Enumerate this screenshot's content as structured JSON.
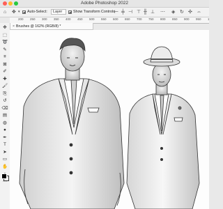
{
  "window": {
    "title": "Adobe Photoshop 2022"
  },
  "options_bar": {
    "home_icon": "home-icon",
    "move_icon": "move-tool-icon",
    "auto_select_label": "Auto-Select:",
    "auto_select_checked": true,
    "auto_select_value": "Layer",
    "show_transform_label": "Show Transform Controls",
    "show_transform_checked": true
  },
  "ruler": {
    "ticks": [
      "200",
      "250",
      "300",
      "350",
      "400",
      "450",
      "500",
      "550",
      "600",
      "650",
      "700",
      "750",
      "800",
      "850",
      "900",
      "950",
      "1000"
    ]
  },
  "document": {
    "tab_label": "Brushes @ 162% (RGB/8) *"
  },
  "tools": [
    "move-tool-icon",
    "marquee-tool-icon",
    "lasso-tool-icon",
    "quick-select-tool-icon",
    "crop-tool-icon",
    "frame-tool-icon",
    "eyedropper-tool-icon",
    "healing-brush-icon",
    "brush-tool-icon",
    "clone-stamp-icon",
    "history-brush-icon",
    "eraser-tool-icon",
    "gradient-tool-icon",
    "blur-tool-icon",
    "dodge-tool-icon",
    "pen-tool-icon",
    "type-tool-icon",
    "path-select-icon",
    "rectangle-tool-icon",
    "hand-tool-icon",
    "zoom-tool-icon",
    "more-tools-icon"
  ],
  "colors": {
    "foreground": "#000000",
    "background": "#ffffff",
    "canvas": "#fdfdfd"
  },
  "artwork": {
    "subject": "two men in suits illustration"
  }
}
